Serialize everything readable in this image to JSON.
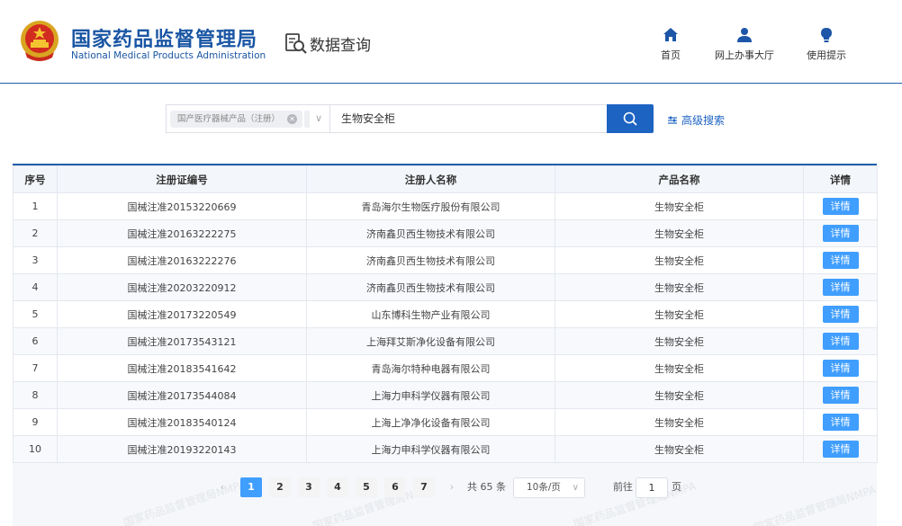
{
  "header": {
    "org_cn": "国家药品监督管理局",
    "org_en": "National Medical Products Administration",
    "query_title": "数据查询",
    "nav": [
      {
        "label": "首页",
        "icon": "home-icon"
      },
      {
        "label": "网上办事大厅",
        "icon": "user-icon"
      },
      {
        "label": "使用提示",
        "icon": "lightbulb-icon"
      }
    ]
  },
  "search": {
    "category_tag": "国产医疗器械产品（注册）",
    "query": "生物安全柜",
    "advanced_label": "高级搜索"
  },
  "table": {
    "headers": [
      "序号",
      "注册证编号",
      "注册人名称",
      "产品名称",
      "详情"
    ],
    "detail_label": "详情",
    "rows": [
      {
        "no": "1",
        "cert": "国械注准20153220669",
        "company": "青岛海尔生物医疗股份有限公司",
        "product": "生物安全柜"
      },
      {
        "no": "2",
        "cert": "国械注准20163222275",
        "company": "济南鑫贝西生物技术有限公司",
        "product": "生物安全柜"
      },
      {
        "no": "3",
        "cert": "国械注准20163222276",
        "company": "济南鑫贝西生物技术有限公司",
        "product": "生物安全柜"
      },
      {
        "no": "4",
        "cert": "国械注准20203220912",
        "company": "济南鑫贝西生物技术有限公司",
        "product": "生物安全柜"
      },
      {
        "no": "5",
        "cert": "国械注准20173220549",
        "company": "山东博科生物产业有限公司",
        "product": "生物安全柜"
      },
      {
        "no": "6",
        "cert": "国械注准20173543121",
        "company": "上海拜艾斯净化设备有限公司",
        "product": "生物安全柜"
      },
      {
        "no": "7",
        "cert": "国械注准20183541642",
        "company": "青岛海尔特种电器有限公司",
        "product": "生物安全柜"
      },
      {
        "no": "8",
        "cert": "国械注准20173544084",
        "company": "上海力申科学仪器有限公司",
        "product": "生物安全柜"
      },
      {
        "no": "9",
        "cert": "国械注准20183540124",
        "company": "上海上净净化设备有限公司",
        "product": "生物安全柜"
      },
      {
        "no": "10",
        "cert": "国械注准20193220143",
        "company": "上海力申科学仪器有限公司",
        "product": "生物安全柜"
      }
    ]
  },
  "pagination": {
    "prev": "‹",
    "next": "›",
    "pages": [
      "1",
      "2",
      "3",
      "4",
      "5",
      "6",
      "7"
    ],
    "current_page": "1",
    "total": "共 65 条",
    "page_size": "10条/页",
    "goto_prefix": "前往",
    "goto_value": "1",
    "goto_suffix": "页"
  },
  "watermark": "国家药品监督管理局NMPA",
  "colors": {
    "brand": "#1a56a4",
    "primary_button": "#1d63c2",
    "detail_button": "#409eff"
  }
}
